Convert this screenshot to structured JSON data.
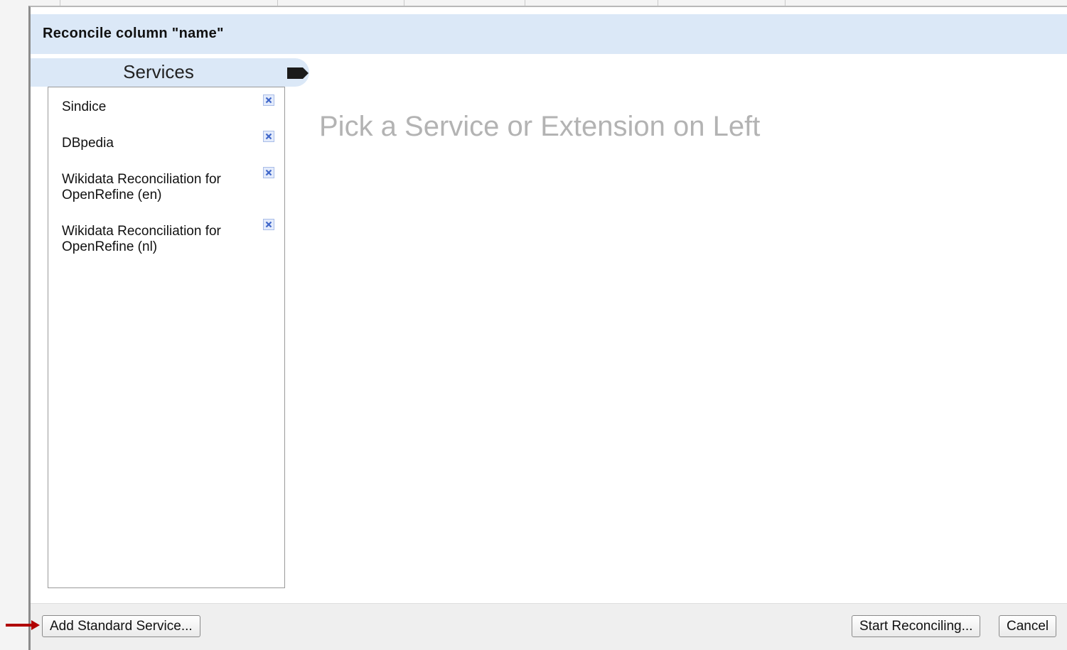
{
  "dialog": {
    "title": "Reconcile column \"name\""
  },
  "services_panel": {
    "tab_label": "Services",
    "tab_icon": "tag-icon",
    "items": [
      {
        "label": "Sindice",
        "remove_icon": "remove-icon"
      },
      {
        "label": "DBpedia",
        "remove_icon": "remove-icon"
      },
      {
        "label": "Wikidata Reconciliation for OpenRefine (en)",
        "remove_icon": "remove-icon"
      },
      {
        "label": "Wikidata Reconciliation for OpenRefine (nl)",
        "remove_icon": "remove-icon"
      }
    ]
  },
  "main": {
    "placeholder": "Pick a Service or Extension on Left"
  },
  "footer": {
    "add_service_label": "Add Standard Service...",
    "start_label": "Start Reconciling...",
    "cancel_label": "Cancel"
  },
  "colors": {
    "header_bg": "#dbe8f7",
    "footer_bg": "#efefef",
    "placeholder_text": "#b3b3b3",
    "annotation_arrow": "#b00000",
    "remove_icon": "#5a7fd6"
  }
}
